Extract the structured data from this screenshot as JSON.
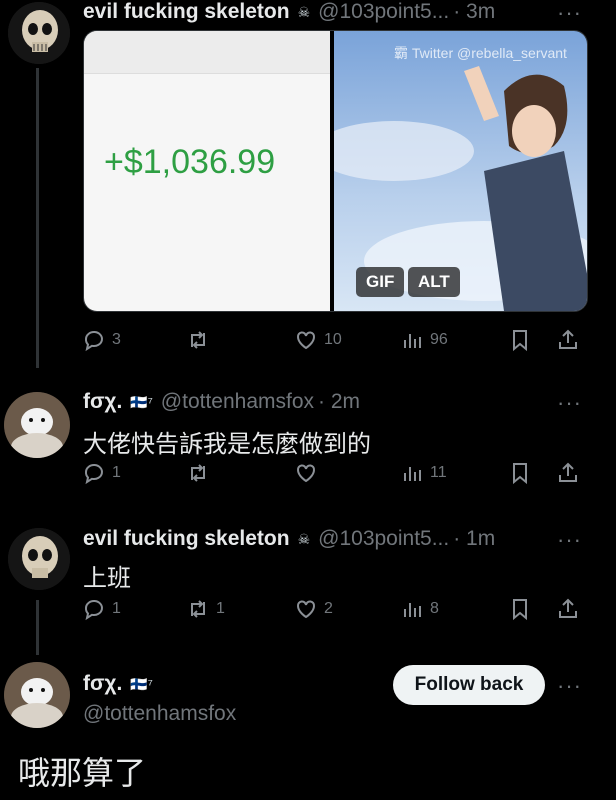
{
  "colors": {
    "background": "#000000",
    "text": "#e7e9ea",
    "secondary": "#71767b",
    "money": "#2e9f43",
    "follow_bg": "#eff3f4"
  },
  "tweets": [
    {
      "name": "evil fucking skeleton",
      "badge": "☠",
      "handle": "@103point5...",
      "time": "· 3m",
      "media": {
        "amount": "+$1,036.99",
        "gif_label": "GIF",
        "alt_label": "ALT",
        "watermark": "霸 Twitter @rebella_servant"
      },
      "stats": {
        "replies": "3",
        "reposts": "",
        "likes": "10",
        "views": "96"
      }
    },
    {
      "name": "fσχ.",
      "badge": "🇫🇮⁷",
      "handle": "@tottenhamsfox",
      "time": "· 2m",
      "text": "大佬快告訴我是怎麼做到的",
      "stats": {
        "replies": "1",
        "reposts": "",
        "likes": "",
        "views": "11"
      }
    },
    {
      "name": "evil fucking skeleton",
      "badge": "☠",
      "handle": "@103point5...",
      "time": "· 1m",
      "text": "上班",
      "stats": {
        "replies": "1",
        "reposts": "1",
        "likes": "2",
        "views": "8"
      }
    }
  ],
  "profile": {
    "name": "fσχ.",
    "badge": "🇫🇮⁷",
    "handle": "@tottenhamsfox",
    "follow_label": "Follow back"
  },
  "overlay_text": "哦那算了",
  "more_label": "···"
}
